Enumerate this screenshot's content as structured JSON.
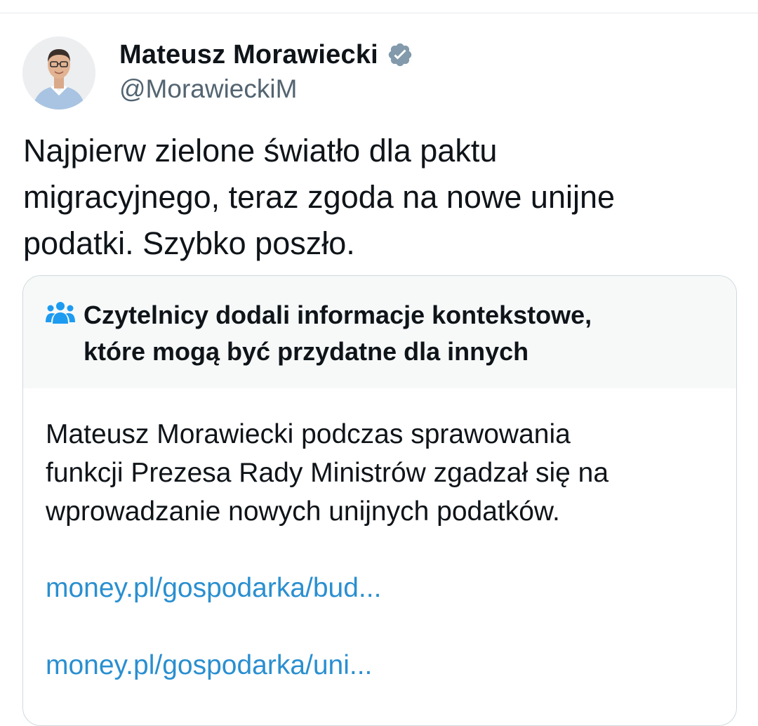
{
  "post": {
    "author": {
      "display_name": "Mateusz Morawiecki",
      "handle": "@MorawieckiM",
      "verified_icon": "verified-badge-icon",
      "verified_color": "#829aab"
    },
    "text_lines": [
      "Najpierw zielone światło dla paktu",
      "migracyjnego, teraz zgoda na nowe unijne",
      "podatki. Szybko poszło."
    ]
  },
  "community_note": {
    "icon": "people-icon",
    "icon_color": "#1d9bf0",
    "title_lines": [
      "Czytelnicy dodali informacje kontekstowe,",
      "które mogą być przydatne dla innych"
    ],
    "body_lines": [
      "Mateusz Morawiecki podczas sprawowania",
      "funkcji Prezesa Rady Ministrów zgadzał się na",
      "wprowadzanie nowych unijnych podatków."
    ],
    "links": [
      "money.pl/gospodarka/bud...",
      "money.pl/gospodarka/uni..."
    ],
    "link_color": "#2a8fd0"
  }
}
